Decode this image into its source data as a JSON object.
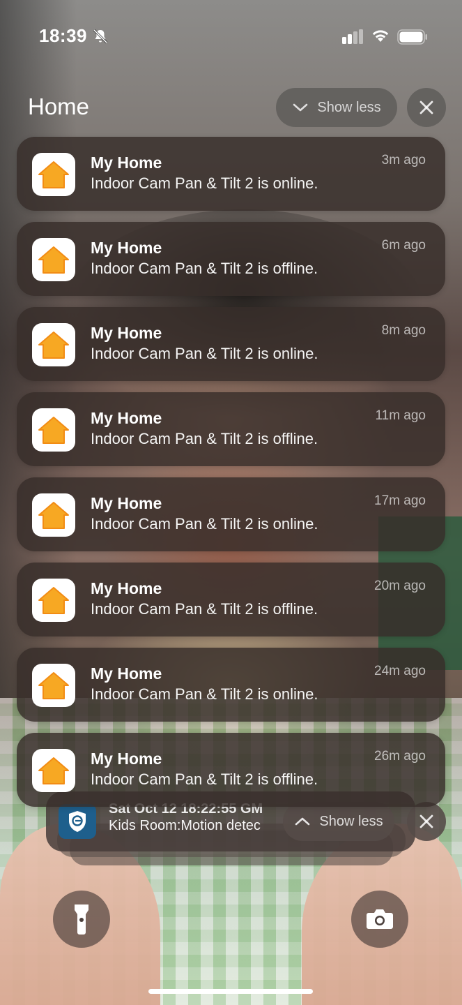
{
  "status_bar": {
    "time": "18:39",
    "icons": [
      "bell-slash-icon",
      "cellular-signal-icon",
      "wifi-icon",
      "battery-icon"
    ]
  },
  "header": {
    "title": "Home",
    "show_less_label": "Show less"
  },
  "notifications": [
    {
      "title": "My Home",
      "body": "Indoor Cam Pan & Tilt 2 is online.",
      "time": "3m ago"
    },
    {
      "title": "My Home",
      "body": "Indoor Cam Pan & Tilt 2 is offline.",
      "time": "6m ago"
    },
    {
      "title": "My Home",
      "body": "Indoor Cam Pan & Tilt 2 is online.",
      "time": "8m ago"
    },
    {
      "title": "My Home",
      "body": "Indoor Cam Pan & Tilt 2 is offline.",
      "time": "11m ago"
    },
    {
      "title": "My Home",
      "body": "Indoor Cam Pan & Tilt 2 is online.",
      "time": "17m ago"
    },
    {
      "title": "My Home",
      "body": "Indoor Cam Pan & Tilt 2 is offline.",
      "time": "20m ago"
    },
    {
      "title": "My Home",
      "body": "Indoor Cam Pan & Tilt 2 is online.",
      "time": "24m ago"
    },
    {
      "title": "My Home",
      "body": "Indoor Cam Pan & Tilt 2 is offline.",
      "time": "26m ago"
    }
  ],
  "second_group": {
    "date_line": "Sat Oct 12 18:22:55 GM",
    "body": "Kids Room:Motion detec",
    "show_less_label": "Show less"
  },
  "colors": {
    "home_icon_orange": "#F7A823",
    "camera_app_blue": "#1E5F8C"
  }
}
